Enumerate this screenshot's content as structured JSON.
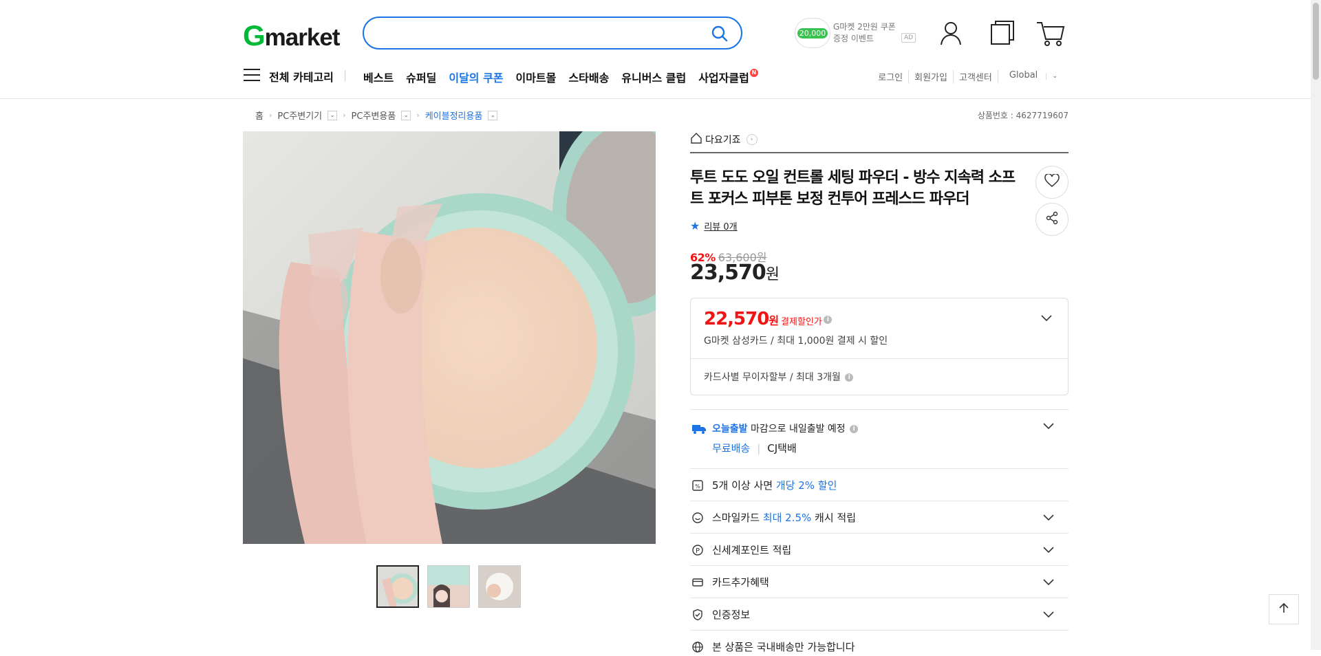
{
  "header": {
    "logo_g": "G",
    "logo_rest": "market",
    "search_placeholder": "",
    "promo": {
      "coin": "20,000",
      "line1": "G마켓 2만원 쿠폰",
      "line2": "증정 이벤트",
      "ad": "AD"
    }
  },
  "nav": {
    "all_categories": "전체 카테고리",
    "links": [
      "베스트",
      "슈퍼딜",
      "이달의 쿠폰",
      "이마트몰",
      "스타배송",
      "유니버스 클럽",
      "사업자클럽"
    ],
    "new_badge": "N",
    "right": [
      "로그인",
      "회원가입",
      "고객센터",
      "Global"
    ]
  },
  "breadcrumb": {
    "home": "홈",
    "items": [
      "PC주변기기",
      "PC주변용품",
      "케이블정리용품"
    ]
  },
  "product_id": "상품번호 : 4627719607",
  "product": {
    "shop": "다요기죠",
    "title": "투트 도도 오일 컨트롤 세팅 파우더 - 방수 지속력 소프트 포커스 피부톤 보정 컨투어 프레스드 파우더",
    "review": "리뷰 0개",
    "discount_pct": "62%",
    "original_price": "63,600원",
    "price": "23,570",
    "won": "원"
  },
  "card_offer": {
    "price": "22,570",
    "won": "원",
    "label": "결제할인가",
    "desc": "G마켓 삼성카드 / 최대 1,000원 결제 시 할인",
    "installment": "카드사별 무이자할부 / 최대 3개월"
  },
  "shipping": {
    "today": "오늘출발",
    "text": "마감으로 내일출발 예정",
    "free": "무료배송",
    "carrier": "CJ택배"
  },
  "benefits": {
    "bulk_pre": "5개 이상 사면 ",
    "bulk_hl": "개당 2% 할인",
    "smile_pre": "스마일카드 ",
    "smile_hl": "최대 2.5%",
    "smile_post": " 캐시 적립",
    "shinsegae": "신세계포인트 적립",
    "card_extra": "카드추가혜택",
    "cert": "인증정보",
    "domestic": "본 상품은 국내배송만 가능합니다"
  },
  "colors": {
    "brand_green": "#00b936",
    "accent_blue": "#1b74e4",
    "discount_red": "#f01414"
  }
}
